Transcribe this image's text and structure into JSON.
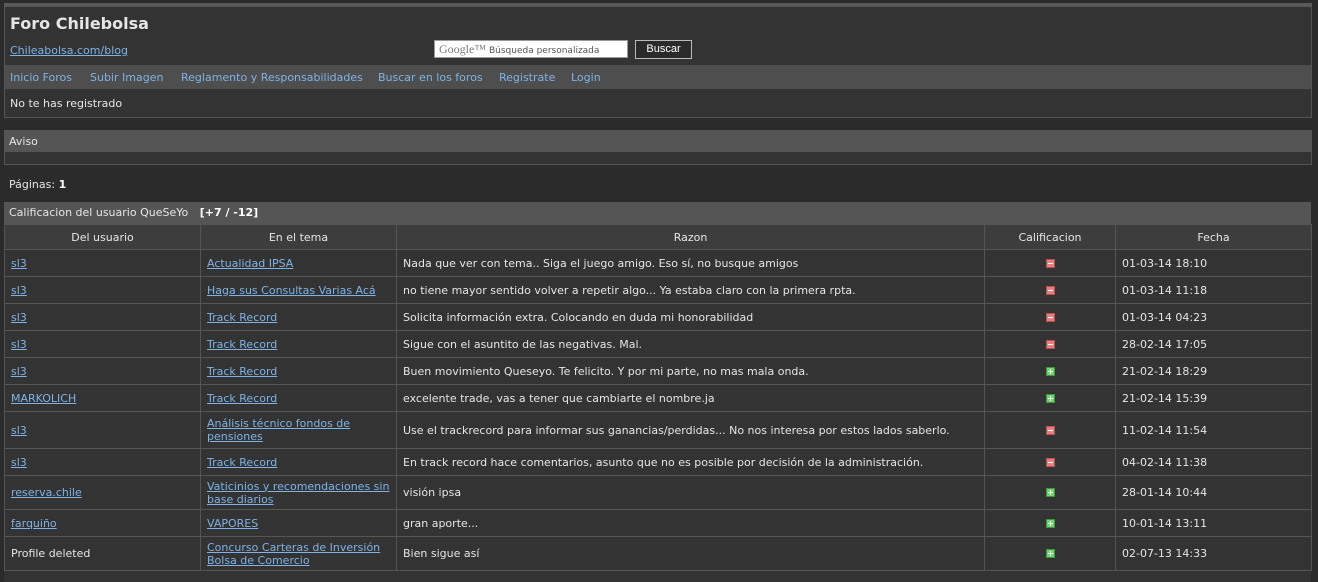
{
  "header": {
    "title": "Foro Chilebolsa",
    "blog_link": "Chileabolsa.com/blog",
    "search_brand": "Google™",
    "search_placeholder": "Búsqueda personalizada",
    "search_button": "Buscar",
    "not_registered": "No te has registrado"
  },
  "nav": {
    "items": [
      "Inicio Foros",
      "Subir Imagen",
      "Reglamento y Responsabilidades",
      "Buscar en los foros",
      "Registrate",
      "Login"
    ]
  },
  "notice": {
    "title": "Aviso"
  },
  "pagination": {
    "label": "Páginas:",
    "current": "1"
  },
  "ratings": {
    "title": "Calificacion del usuario QueSeYo",
    "summary": "[+7 / -12]",
    "columns": [
      "Del usuario",
      "En el tema",
      "Razon",
      "Calificacion",
      "Fecha"
    ],
    "rows": [
      {
        "user": "sl3",
        "topic": "Actualidad IPSA",
        "reason": "Nada que ver con tema..  Siga el juego amigo. Eso sí, no busque amigos",
        "rating": "negative",
        "date": "01-03-14 18:10"
      },
      {
        "user": "sl3",
        "topic": "Haga sus Consultas Varias Acá",
        "reason": "no tiene mayor sentido volver a repetir algo... Ya estaba claro con la primera rpta.",
        "rating": "negative",
        "date": "01-03-14 11:18"
      },
      {
        "user": "sl3",
        "topic": "Track Record",
        "reason": "Solicita información extra. Colocando en duda mi honorabilidad",
        "rating": "negative",
        "date": "01-03-14 04:23"
      },
      {
        "user": "sl3",
        "topic": "Track Record",
        "reason": "Sigue con el asuntito de las negativas. Mal.",
        "rating": "negative",
        "date": "28-02-14 17:05"
      },
      {
        "user": "sl3",
        "topic": "Track Record",
        "reason": "Buen movimiento Queseyo. Te felicito.  Y por mi parte, no mas mala onda.",
        "rating": "positive",
        "date": "21-02-14 18:29"
      },
      {
        "user": "MARKOLICH",
        "topic": "Track Record",
        "reason": "excelente trade,  vas  a tener que  cambiarte  el nombre.ja",
        "rating": "positive",
        "date": "21-02-14 15:39"
      },
      {
        "user": "sl3",
        "topic": "Análisis técnico fondos de pensiones",
        "reason": "Use el trackrecord para informar sus ganancias/perdidas... No nos interesa por estos lados saberlo.",
        "rating": "negative",
        "date": "11-02-14 11:54"
      },
      {
        "user": "sl3",
        "topic": "Track Record",
        "reason": "En track record hace comentarios, asunto que no es posible por decisión de la administración.",
        "rating": "negative",
        "date": "04-02-14 11:38"
      },
      {
        "user": "reserva.chile",
        "topic": "Vaticinios y recomendaciones sin base diarios",
        "reason": "visión ipsa",
        "rating": "positive",
        "date": "28-01-14 10:44"
      },
      {
        "user": "farquiño",
        "topic": "VAPORES",
        "reason": "gran aporte...",
        "rating": "positive",
        "date": "10-01-14 13:11"
      },
      {
        "user": "Profile deleted",
        "topic": "Concurso Carteras de Inversión Bolsa de Comercio",
        "reason": "Bien sigue así",
        "rating": "positive",
        "date": "02-07-13 14:33"
      }
    ]
  }
}
